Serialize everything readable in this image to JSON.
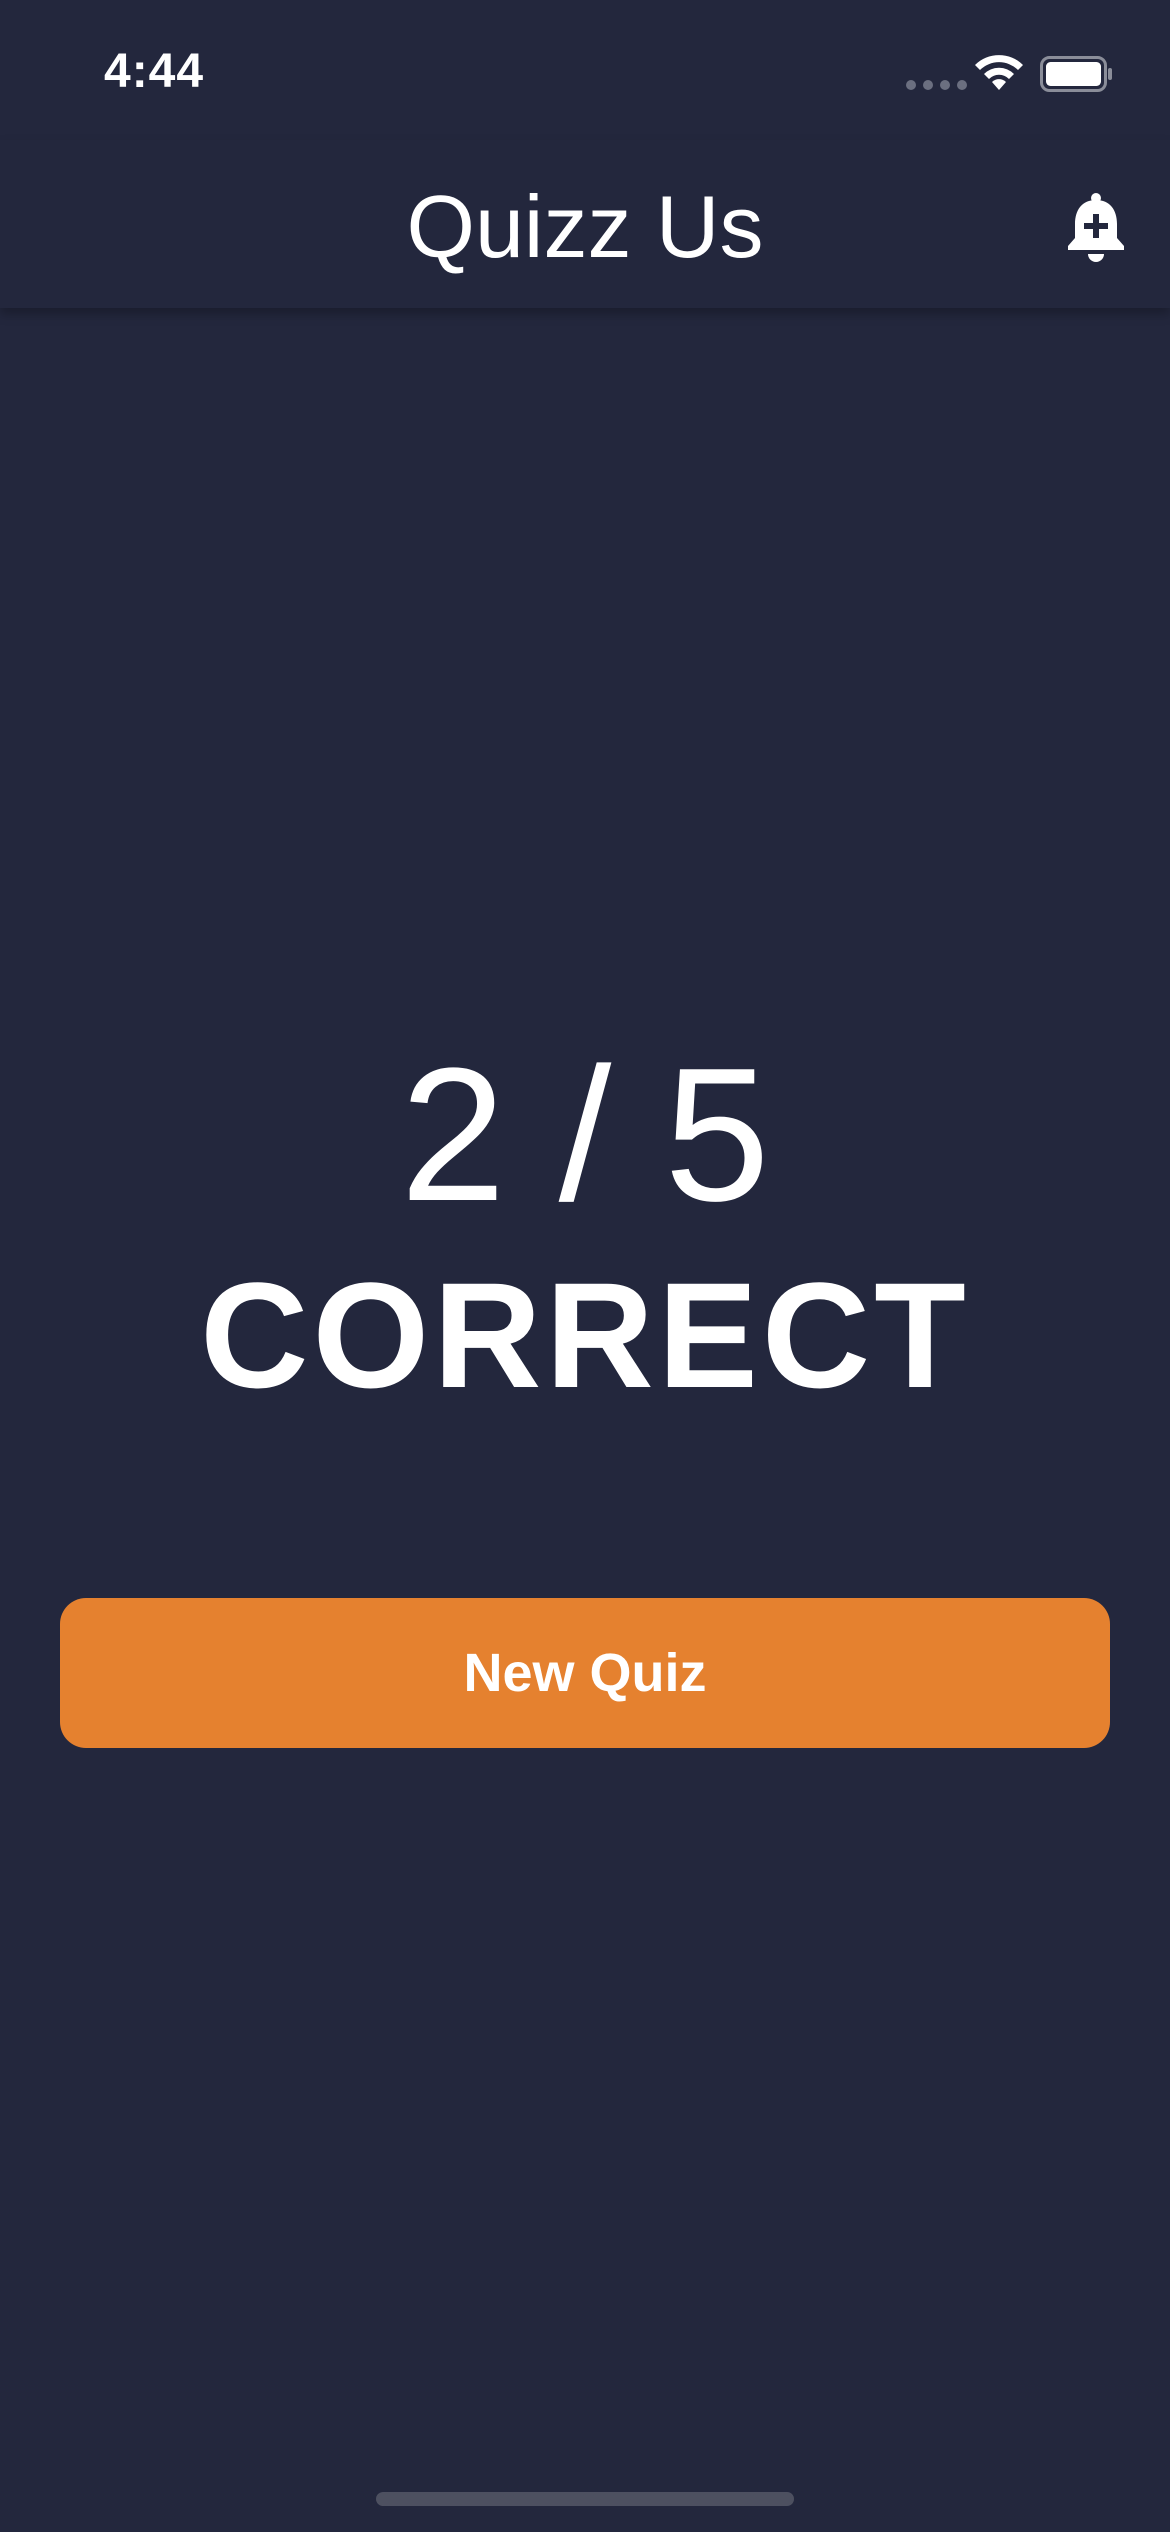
{
  "status_bar": {
    "time": "4:44"
  },
  "header": {
    "title": "Quizz Us",
    "bell_icon": "bell-plus-icon"
  },
  "result": {
    "score": "2 / 5",
    "label": "CORRECT",
    "correct": 2,
    "total": 5
  },
  "actions": {
    "new_quiz_label": "New Quiz"
  },
  "colors": {
    "background": "#23273d",
    "accent": "#e5812f",
    "text": "#ffffff"
  }
}
